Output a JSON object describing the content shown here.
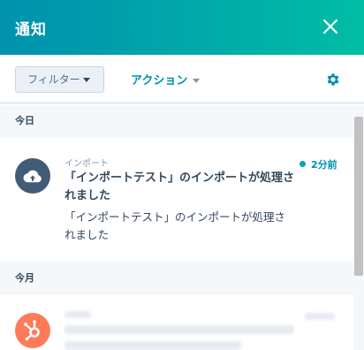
{
  "header": {
    "title": "通知"
  },
  "toolbar": {
    "filter_label": "フィルター",
    "action_label": "アクション"
  },
  "sections": [
    {
      "label": "今日",
      "items": [
        {
          "source": "インポート",
          "title": "「インポートテスト」のインポートが処理されました",
          "body": "「インポートテスト」のインポートが処理されました",
          "time": "2分前",
          "unread": true,
          "icon": "cloud-upload-icon"
        }
      ]
    },
    {
      "label": "今月",
      "items": [
        {
          "icon": "hubspot-sprocket-icon"
        }
      ]
    }
  ],
  "colors": {
    "header_gradient_start": "#0091ae",
    "header_gradient_end": "#00bda5",
    "accent": "#0091ae",
    "avatar_dark": "#425b76",
    "avatar_orange": "#ff7a59"
  }
}
